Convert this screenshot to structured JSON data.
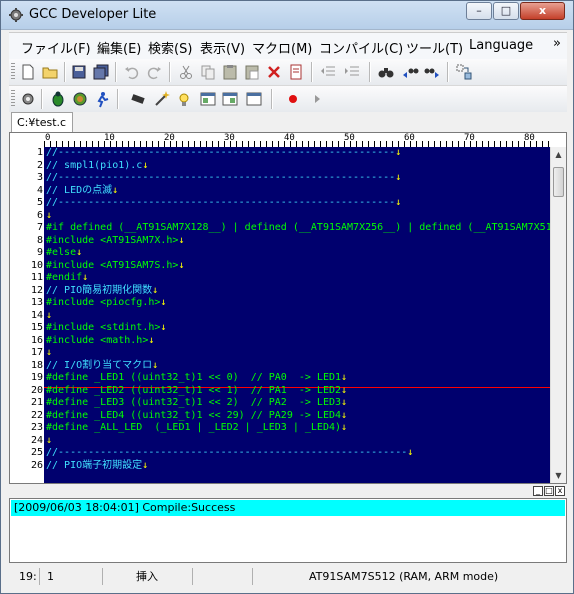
{
  "window": {
    "title": "GCC Developer Lite",
    "min_label": "–",
    "max_label": "□",
    "close_label": "x"
  },
  "menu": {
    "items": [
      "ファイル(F)",
      "編集(E)",
      "検索(S)",
      "表示(V)",
      "マクロ(M)",
      "コンパイル(C)",
      "ツール(T)",
      "Language"
    ],
    "more": "»"
  },
  "toolbar1": {
    "icons": [
      "new-file-icon",
      "open-folder-icon",
      "save-icon",
      "save-all-icon",
      "undo-icon",
      "redo-icon",
      "cut-icon",
      "copy-icon",
      "paste-icon",
      "paste-special-icon",
      "delete-icon",
      "clipboard-icon",
      "outdent-icon",
      "indent-icon",
      "find-icon",
      "find-prev-icon",
      "find-next-icon",
      "replace-icon"
    ]
  },
  "toolbar2": {
    "icons": [
      "settings-gear-icon",
      "bug-icon",
      "compile-icon",
      "run-icon",
      "chip-icon",
      "wizard-icon",
      "light-icon",
      "window-a-icon",
      "window-b-icon",
      "window-c-icon",
      "breakpoint-icon",
      "play-icon"
    ]
  },
  "tab": {
    "label": "C:¥test.c"
  },
  "ruler": {
    "labels": [
      "0",
      "10",
      "20",
      "30",
      "40",
      "50",
      "60",
      "70",
      "80"
    ]
  },
  "editor": {
    "lines": [
      {
        "n": "1",
        "t": "//--------------------------------------------------------",
        "cls": "c-comment",
        "eol": "↓"
      },
      {
        "n": "2",
        "t": "// smpl1(pio1).c",
        "cls": "c-comment",
        "eol": "↓"
      },
      {
        "n": "3",
        "t": "//--------------------------------------------------------",
        "cls": "c-comment",
        "eol": "↓"
      },
      {
        "n": "4",
        "t": "// LEDの点滅",
        "cls": "c-comment",
        "eol": "↓"
      },
      {
        "n": "5",
        "t": "//--------------------------------------------------------",
        "cls": "c-comment",
        "eol": "↓"
      },
      {
        "n": "6",
        "t": "",
        "cls": "c-text",
        "eol": "↓"
      },
      {
        "n": "7",
        "t": "#if defined (__AT91SAM7X128__) | defined (__AT91SAM7X256__) | defined (__AT91SAM7X51",
        "cls": "c-pre",
        "eol": ""
      },
      {
        "n": "8",
        "t": "#include <AT91SAM7X.h>",
        "cls": "c-pre",
        "eol": "↓"
      },
      {
        "n": "9",
        "t": "#else",
        "cls": "c-pre",
        "eol": "↓"
      },
      {
        "n": "10",
        "t": "#include <AT91SAM7S.h>",
        "cls": "c-pre",
        "eol": "↓"
      },
      {
        "n": "11",
        "t": "#endif",
        "cls": "c-pre",
        "eol": "↓"
      },
      {
        "n": "12",
        "t": "// PIO簡易初期化関数",
        "cls": "c-comment",
        "eol": "↓"
      },
      {
        "n": "13",
        "t": "#include <piocfg.h>",
        "cls": "c-pre",
        "eol": "↓"
      },
      {
        "n": "14",
        "t": "",
        "cls": "c-text",
        "eol": "↓"
      },
      {
        "n": "15",
        "t": "#include <stdint.h>",
        "cls": "c-pre",
        "eol": "↓"
      },
      {
        "n": "16",
        "t": "#include <math.h>",
        "cls": "c-pre",
        "eol": "↓"
      },
      {
        "n": "17",
        "t": "",
        "cls": "c-text",
        "eol": "↓"
      },
      {
        "n": "18",
        "t": "// I/O割り当てマクロ",
        "cls": "c-comment",
        "eol": "↓"
      },
      {
        "n": "19",
        "t": "#define _LED1 ((uint32_t)1 << 0)  // PA0  -> LED1",
        "cls": "c-pre",
        "eol": "↓"
      },
      {
        "n": "20",
        "t": "#define _LED2 ((uint32_t)1 << 1)  // PA1  -> LED2",
        "cls": "c-pre",
        "eol": "↓"
      },
      {
        "n": "21",
        "t": "#define _LED3 ((uint32_t)1 << 2)  // PA2  -> LED3",
        "cls": "c-pre",
        "eol": "↓"
      },
      {
        "n": "22",
        "t": "#define _LED4 ((uint32_t)1 << 29) // PA29 -> LED4",
        "cls": "c-pre",
        "eol": "↓"
      },
      {
        "n": "23",
        "t": "#define _ALL_LED  (_LED1 | _LED2 | _LED3 | _LED4)",
        "cls": "c-pre",
        "eol": "↓"
      },
      {
        "n": "24",
        "t": "",
        "cls": "c-text",
        "eol": "↓"
      },
      {
        "n": "25",
        "t": "//----------------------------------------------------------",
        "cls": "c-comment",
        "eol": "↓"
      },
      {
        "n": "26",
        "t": "// PIO端子初期設定",
        "cls": "c-comment",
        "eol": "↓"
      }
    ]
  },
  "output": {
    "controls": [
      "_",
      "□",
      "x"
    ],
    "line": "[2009/06/03 18:04:01] Compile:Success"
  },
  "status": {
    "line": "19:",
    "col": "1",
    "mode": "挿入",
    "target": "AT91SAM7S512 (RAM, ARM mode)"
  },
  "colors": {
    "editor_bg": "#00006e",
    "comment": "#40e0ff",
    "preprocessor": "#00ff00",
    "eol_marker": "#ffff00",
    "output_highlight": "#00ffff"
  }
}
